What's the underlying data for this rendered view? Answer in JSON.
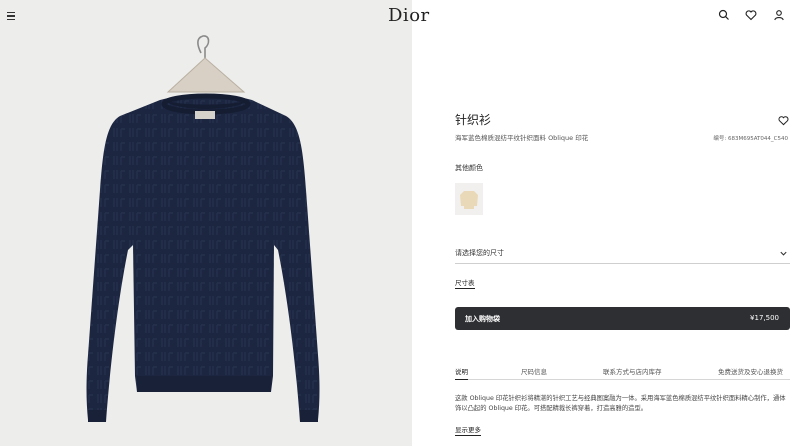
{
  "header": {
    "logo": "Dior",
    "menu_icon": "menu-icon",
    "icons": [
      "search-icon",
      "heart-icon",
      "user-icon"
    ]
  },
  "product": {
    "title": "针织衫",
    "subtitle": "海军蓝色棉质混纺平纹针织面料 Oblique 印花",
    "reference": "编号: 683M695AT044_C540",
    "other_colors_label": "其他颜色",
    "size_select_label": "请选择您的尺寸",
    "size_guide_label": "尺寸表",
    "add_to_cart_label": "加入购物袋",
    "price": "¥17,500"
  },
  "tabs": [
    "说明",
    "尺码信息",
    "联系方式与店内库存",
    "免费送货及安心退换货"
  ],
  "active_tab": 0,
  "description": "这款 Oblique 印花针织衫将精湛的针织工艺与经典图案融为一体。采用海军蓝色棉质混纺平纹针织面料精心制作，通体饰以凸起的 Oblique 印花。可搭配精裁长裤穿着，打造高雅的造型。",
  "show_more_label": "显示更多",
  "colors": {
    "sweater_main": "#1c2640",
    "sweater_swatch": "#ead9b8",
    "background": "#ededeb",
    "button": "#2e2f33"
  }
}
